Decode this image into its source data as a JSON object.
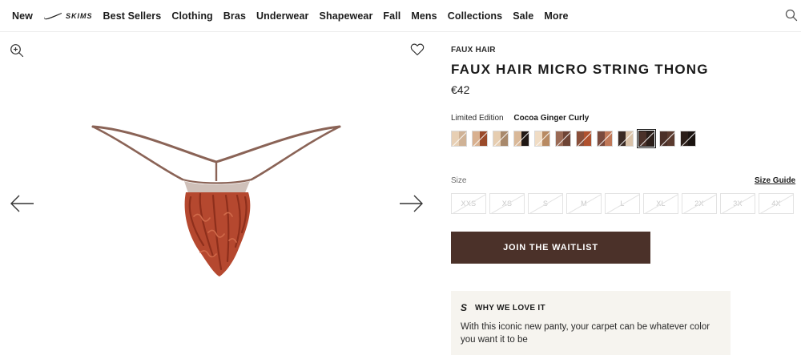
{
  "nav": {
    "items": [
      "New",
      "Best Sellers",
      "Clothing",
      "Bras",
      "Underwear",
      "Shapewear",
      "Fall",
      "Mens",
      "Collections",
      "Sale",
      "More"
    ],
    "brand_logo_text": "SKIMS"
  },
  "product": {
    "eyebrow": "FAUX HAIR",
    "title": "FAUX HAIR MICRO STRING THONG",
    "price": "€42",
    "color_prefix": "Limited Edition",
    "color_selected": "Cocoa Ginger Curly",
    "swatches": [
      {
        "left": "#e7cfb4",
        "right": "#cfb296",
        "selected": false
      },
      {
        "left": "#d8b08f",
        "right": "#9a4a2a",
        "selected": false
      },
      {
        "left": "#e6cdb0",
        "right": "#a8896c",
        "selected": false
      },
      {
        "left": "#d9b898",
        "right": "#1f1714",
        "selected": false
      },
      {
        "left": "#f0dcc4",
        "right": "#b88a62",
        "selected": false
      },
      {
        "left": "#9a6a55",
        "right": "#6e4435",
        "selected": false
      },
      {
        "left": "#8a4f3a",
        "right": "#b0512e",
        "selected": false
      },
      {
        "left": "#7a4a3d",
        "right": "#c07858",
        "selected": false
      },
      {
        "left": "#3a2a24",
        "right": "#d9c2a9",
        "selected": false
      },
      {
        "left": "#4b3129",
        "right": "#2c1f1a",
        "selected": true
      },
      {
        "left": "#4a2f28",
        "right": "#5a3a2f",
        "selected": false
      },
      {
        "left": "#2a1d18",
        "right": "#1a1310",
        "selected": false
      }
    ],
    "size_label": "Size",
    "size_guide": "Size Guide",
    "sizes": [
      "XXS",
      "XS",
      "S",
      "M",
      "L",
      "XL",
      "2X",
      "3X",
      "4X"
    ],
    "cta": "JOIN THE WAITLIST",
    "why": {
      "icon": "S",
      "title": "WHY WE LOVE IT",
      "text": "With this iconic new panty, your carpet can be whatever color you want it to be"
    }
  },
  "icons": {
    "search": "search-icon",
    "zoom": "zoom-in-icon",
    "favorite": "heart-icon",
    "prev": "arrow-left-icon",
    "next": "arrow-right-icon"
  },
  "colors": {
    "cta_bg": "#4b3129",
    "info_box_bg": "#f6f4ef",
    "strap": "#8a6356",
    "hair": "#b5482f"
  }
}
